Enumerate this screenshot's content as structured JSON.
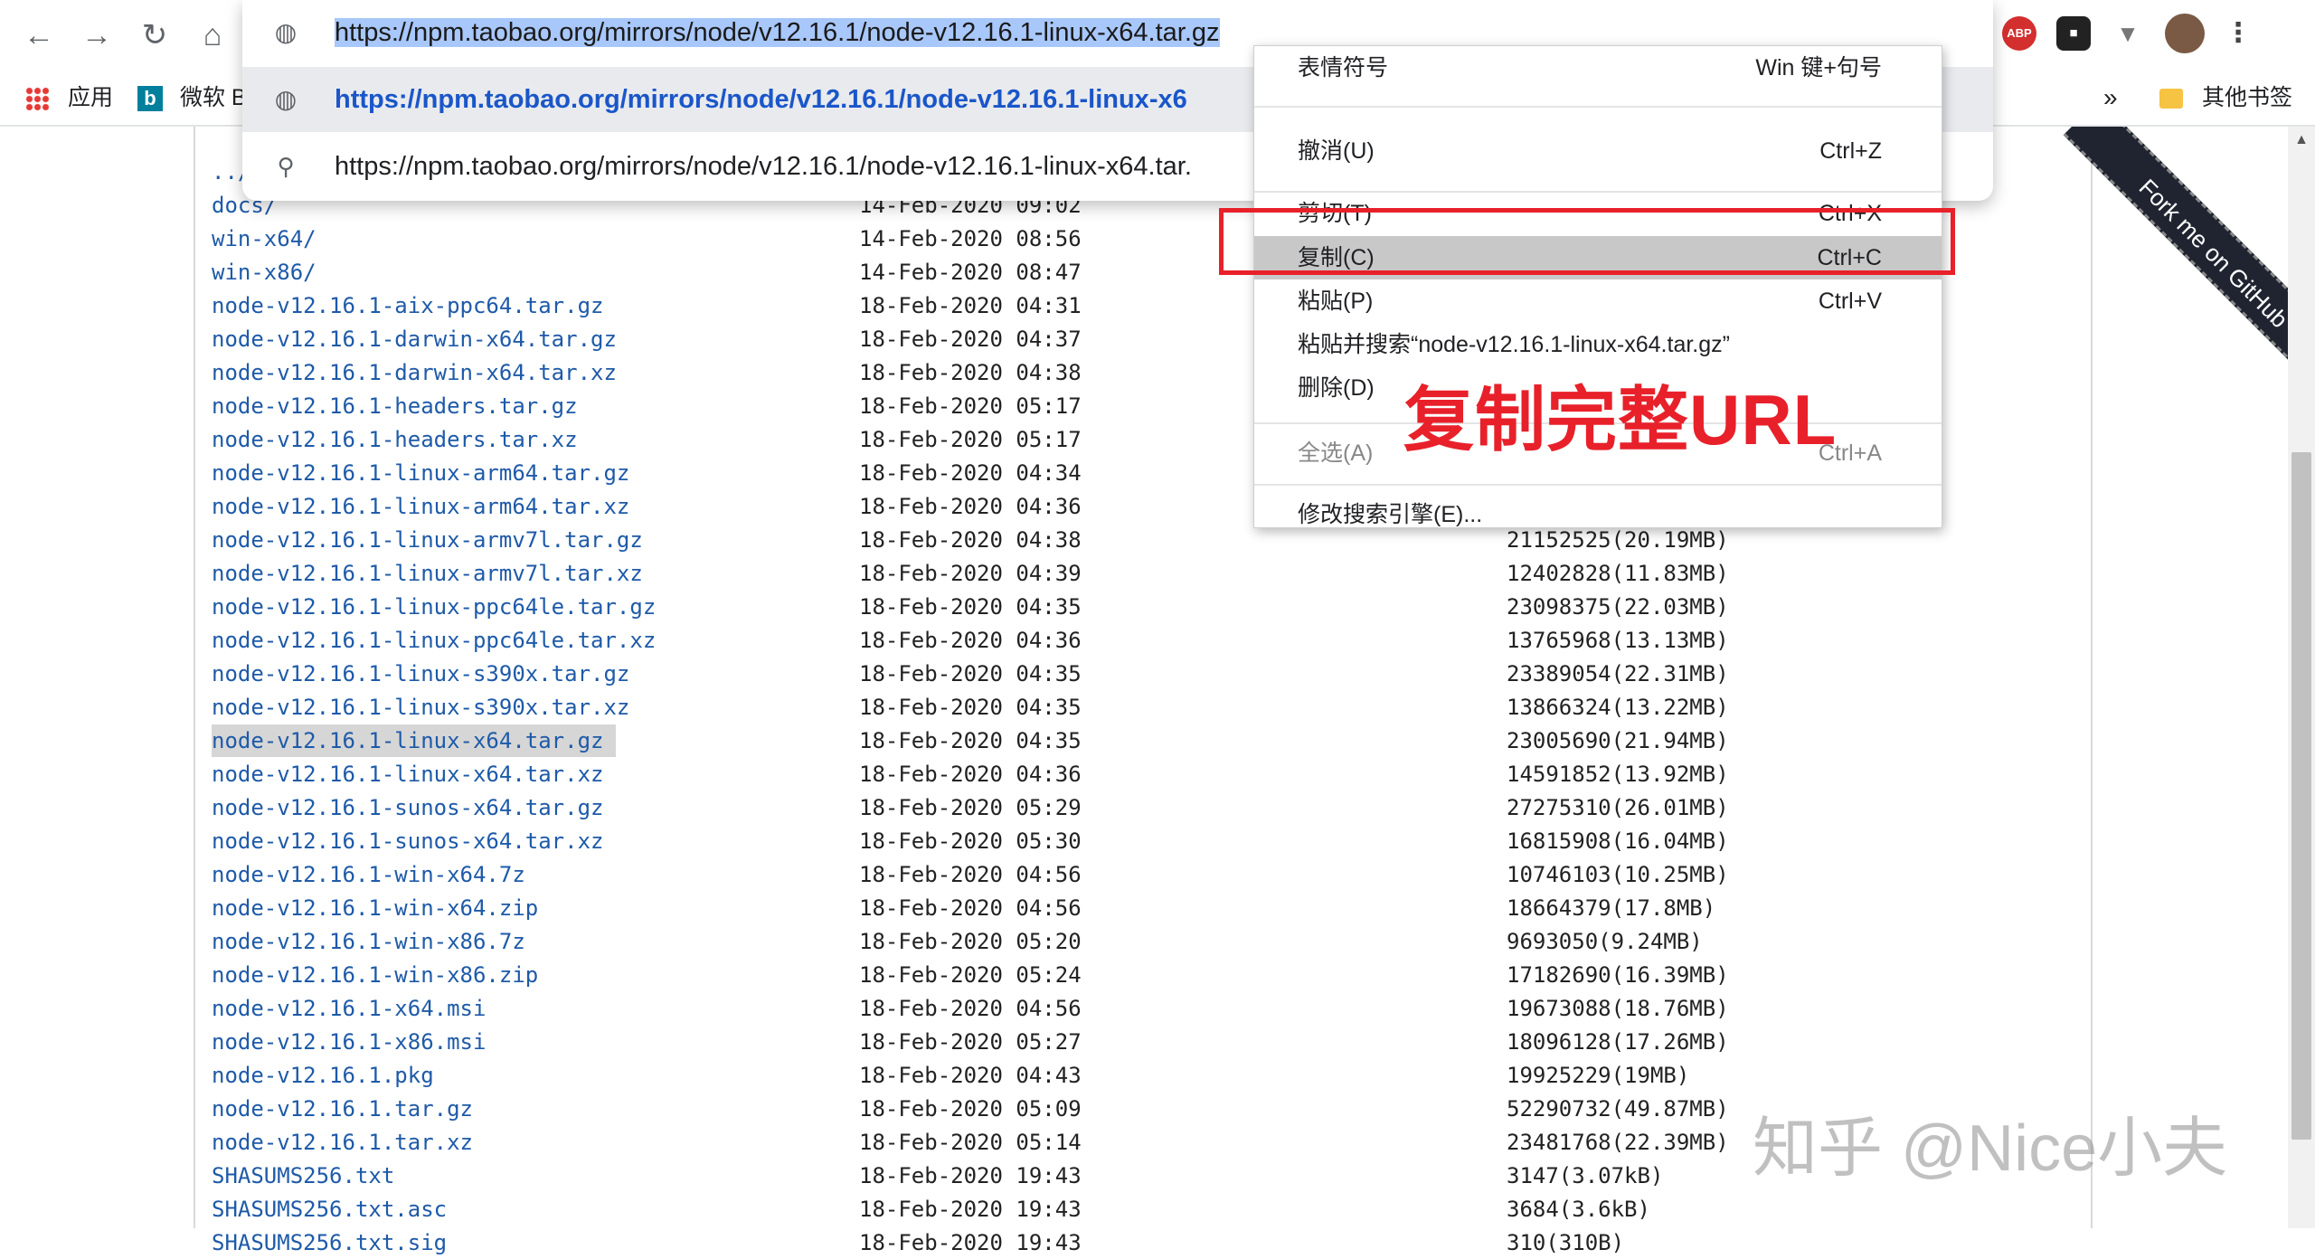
{
  "browser": {
    "url": "https://npm.taobao.org/mirrors/node/v12.16.1/node-v12.16.1-linux-x64.tar.gz",
    "suggestion_bold": "https://npm.taobao.org/mirrors/node/v12.16.1/node-v12.16.1-linux-x6",
    "suggestion_search": "https://npm.taobao.org/mirrors/node/v12.16.1/node-v12.16.1-linux-x64.tar.",
    "extensions": [
      "ABP"
    ],
    "bookmarks": [
      {
        "label": "应用",
        "icon": "apps-grid-icon"
      },
      {
        "label": "微软 B",
        "icon": "bing-icon"
      }
    ],
    "bookmarks_more": "»",
    "bookmarks_other": "其他书签"
  },
  "context_menu": {
    "items": [
      {
        "label": "表情符号",
        "shortcut": "Win 键+句号"
      },
      {
        "label": "撤消(U)",
        "shortcut": "Ctrl+Z"
      },
      {
        "label": "剪切(T)",
        "shortcut": "Ctrl+X"
      },
      {
        "label": "复制(C)",
        "shortcut": "Ctrl+C"
      },
      {
        "label": "粘贴(P)",
        "shortcut": "Ctrl+V"
      },
      {
        "label": "粘贴并搜索“node-v12.16.1-linux-x64.tar.gz”",
        "shortcut": ""
      },
      {
        "label": "删除(D)",
        "shortcut": ""
      },
      {
        "label": "全选(A)",
        "shortcut": "Ctrl+A"
      },
      {
        "label": "修改搜索引擎(E)...",
        "shortcut": ""
      }
    ]
  },
  "annotation": "复制完整URL",
  "ribbon": "Fork me on GitHub",
  "watermark": "知乎 @Nice小夫",
  "listing": {
    "rows": [
      {
        "name": "../",
        "date": "",
        "size": ""
      },
      {
        "name": "docs/",
        "date": "14-Feb-2020 09:02",
        "size": ""
      },
      {
        "name": "win-x64/",
        "date": "14-Feb-2020 08:56",
        "size": ""
      },
      {
        "name": "win-x86/",
        "date": "14-Feb-2020 08:47",
        "size": ""
      },
      {
        "name": "node-v12.16.1-aix-ppc64.tar.gz",
        "date": "18-Feb-2020 04:31",
        "size": ""
      },
      {
        "name": "node-v12.16.1-darwin-x64.tar.gz",
        "date": "18-Feb-2020 04:37",
        "size": ""
      },
      {
        "name": "node-v12.16.1-darwin-x64.tar.xz",
        "date": "18-Feb-2020 04:38",
        "size": ""
      },
      {
        "name": "node-v12.16.1-headers.tar.gz",
        "date": "18-Feb-2020 05:17",
        "size": ""
      },
      {
        "name": "node-v12.16.1-headers.tar.xz",
        "date": "18-Feb-2020 05:17",
        "size": ""
      },
      {
        "name": "node-v12.16.1-linux-arm64.tar.gz",
        "date": "18-Feb-2020 04:34",
        "size": ""
      },
      {
        "name": "node-v12.16.1-linux-arm64.tar.xz",
        "date": "18-Feb-2020 04:36",
        "size": ""
      },
      {
        "name": "node-v12.16.1-linux-armv7l.tar.gz",
        "date": "18-Feb-2020 04:38",
        "size": "21152525(20.19MB)"
      },
      {
        "name": "node-v12.16.1-linux-armv7l.tar.xz",
        "date": "18-Feb-2020 04:39",
        "size": "12402828(11.83MB)"
      },
      {
        "name": "node-v12.16.1-linux-ppc64le.tar.gz",
        "date": "18-Feb-2020 04:35",
        "size": "23098375(22.03MB)"
      },
      {
        "name": "node-v12.16.1-linux-ppc64le.tar.xz",
        "date": "18-Feb-2020 04:36",
        "size": "13765968(13.13MB)"
      },
      {
        "name": "node-v12.16.1-linux-s390x.tar.gz",
        "date": "18-Feb-2020 04:35",
        "size": "23389054(22.31MB)"
      },
      {
        "name": "node-v12.16.1-linux-s390x.tar.xz",
        "date": "18-Feb-2020 04:35",
        "size": "13866324(13.22MB)"
      },
      {
        "name": "node-v12.16.1-linux-x64.tar.gz",
        "date": "18-Feb-2020 04:35",
        "size": "23005690(21.94MB)",
        "selected": true
      },
      {
        "name": "node-v12.16.1-linux-x64.tar.xz",
        "date": "18-Feb-2020 04:36",
        "size": "14591852(13.92MB)"
      },
      {
        "name": "node-v12.16.1-sunos-x64.tar.gz",
        "date": "18-Feb-2020 05:29",
        "size": "27275310(26.01MB)"
      },
      {
        "name": "node-v12.16.1-sunos-x64.tar.xz",
        "date": "18-Feb-2020 05:30",
        "size": "16815908(16.04MB)"
      },
      {
        "name": "node-v12.16.1-win-x64.7z",
        "date": "18-Feb-2020 04:56",
        "size": "10746103(10.25MB)"
      },
      {
        "name": "node-v12.16.1-win-x64.zip",
        "date": "18-Feb-2020 04:56",
        "size": "18664379(17.8MB)"
      },
      {
        "name": "node-v12.16.1-win-x86.7z",
        "date": "18-Feb-2020 05:20",
        "size": "9693050(9.24MB)"
      },
      {
        "name": "node-v12.16.1-win-x86.zip",
        "date": "18-Feb-2020 05:24",
        "size": "17182690(16.39MB)"
      },
      {
        "name": "node-v12.16.1-x64.msi",
        "date": "18-Feb-2020 04:56",
        "size": "19673088(18.76MB)"
      },
      {
        "name": "node-v12.16.1-x86.msi",
        "date": "18-Feb-2020 05:27",
        "size": "18096128(17.26MB)"
      },
      {
        "name": "node-v12.16.1.pkg",
        "date": "18-Feb-2020 04:43",
        "size": "19925229(19MB)"
      },
      {
        "name": "node-v12.16.1.tar.gz",
        "date": "18-Feb-2020 05:09",
        "size": "52290732(49.87MB)"
      },
      {
        "name": "node-v12.16.1.tar.xz",
        "date": "18-Feb-2020 05:14",
        "size": "23481768(22.39MB)"
      },
      {
        "name": "SHASUMS256.txt",
        "date": "18-Feb-2020 19:43",
        "size": "3147(3.07kB)"
      },
      {
        "name": "SHASUMS256.txt.asc",
        "date": "18-Feb-2020 19:43",
        "size": "3684(3.6kB)"
      },
      {
        "name": "SHASUMS256.txt.sig",
        "date": "18-Feb-2020 19:43",
        "size": "310(310B)"
      }
    ]
  }
}
